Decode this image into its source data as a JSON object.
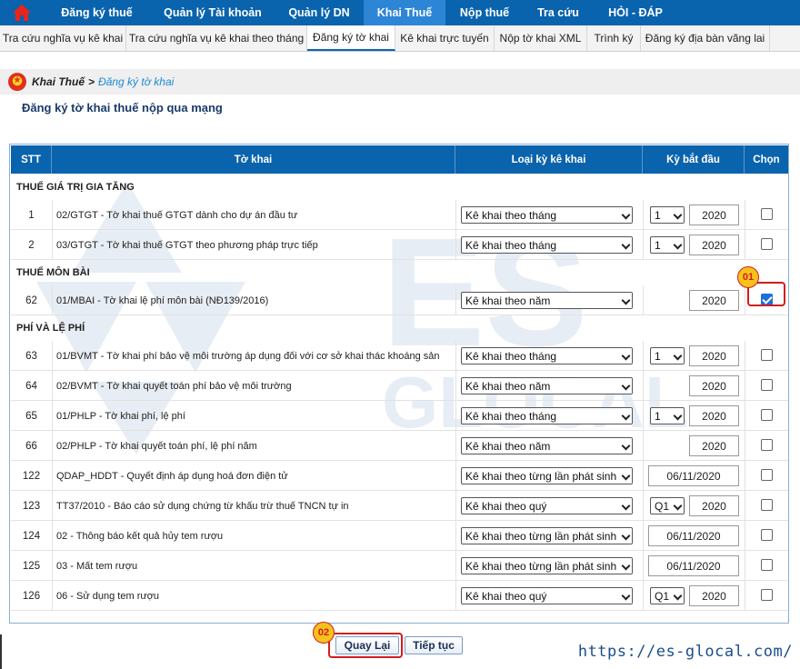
{
  "top_nav": {
    "home_icon": "home-icon",
    "items": [
      {
        "label": "Đăng ký thuế",
        "active": false
      },
      {
        "label": "Quản lý Tài khoản",
        "active": false
      },
      {
        "label": "Quản lý DN",
        "active": false
      },
      {
        "label": "Khai Thuế",
        "active": true
      },
      {
        "label": "Nộp thuế",
        "active": false
      },
      {
        "label": "Tra cứu",
        "active": false
      },
      {
        "label": "HỎI - ĐÁP",
        "active": false
      }
    ]
  },
  "sub_nav": {
    "items": [
      {
        "label": "Tra cứu nghĩa vụ kê khai",
        "active": false
      },
      {
        "label": "Tra cứu nghĩa vụ kê khai theo tháng",
        "active": false
      },
      {
        "label": "Đăng ký tờ khai",
        "active": true
      },
      {
        "label": "Kê khai trực tuyến",
        "active": false
      },
      {
        "label": "Nộp tờ khai XML",
        "active": false
      },
      {
        "label": "Trình ký",
        "active": false
      },
      {
        "label": "Đăng ký địa bàn vãng lai",
        "active": false
      }
    ]
  },
  "breadcrumb": {
    "root": "Khai Thuế",
    "separator": ">",
    "current": "Đăng ký tờ khai"
  },
  "page_title": "Đăng ký tờ khai thuế nộp qua mạng",
  "table": {
    "headers": {
      "stt": "STT",
      "to_khai": "Tờ khai",
      "loai_ky": "Loại kỳ kê khai",
      "ky_bat_dau": "Kỳ bắt đầu",
      "chon": "Chọn"
    },
    "sections": [
      {
        "title": "THUẾ GIÁ TRỊ GIA TĂNG",
        "rows": [
          {
            "stt": "1",
            "name": "02/GTGT - Tờ khai thuế GTGT dành cho dự án đầu tư",
            "loai": "Kê khai theo tháng",
            "period": "1",
            "year": "2020",
            "checked": false
          },
          {
            "stt": "2",
            "name": "03/GTGT - Tờ khai thuế GTGT theo phương pháp trực tiếp",
            "loai": "Kê khai theo tháng",
            "period": "1",
            "year": "2020",
            "checked": false
          }
        ]
      },
      {
        "title": "THUẾ MÔN BÀI",
        "rows": [
          {
            "stt": "62",
            "name": "01/MBAI - Tờ khai lệ phí môn bài (NĐ139/2016)",
            "loai": "Kê khai theo năm",
            "period": "",
            "year": "2020",
            "checked": true
          }
        ]
      },
      {
        "title": "PHÍ VÀ LỆ PHÍ",
        "rows": [
          {
            "stt": "63",
            "name": "01/BVMT - Tờ khai phí bảo vệ môi trường áp dụng đối với cơ sở khai thác khoáng sản",
            "loai": "Kê khai theo tháng",
            "period": "1",
            "year": "2020",
            "checked": false
          },
          {
            "stt": "64",
            "name": "02/BVMT - Tờ khai quyết toán phí bảo vệ môi trường",
            "loai": "Kê khai theo năm",
            "period": "",
            "year": "2020",
            "checked": false
          },
          {
            "stt": "65",
            "name": "01/PHLP - Tờ khai phí, lệ phí",
            "loai": "Kê khai theo tháng",
            "period": "1",
            "year": "2020",
            "checked": false
          },
          {
            "stt": "66",
            "name": "02/PHLP - Tờ khai quyết toán phí, lệ phí năm",
            "loai": "Kê khai theo năm",
            "period": "",
            "year": "2020",
            "checked": false
          },
          {
            "stt": "122",
            "name": "QDAP_HDDT - Quyết định áp dụng hoá đơn điện tử",
            "loai": "Kê khai theo từng lần phát sinh",
            "period": "",
            "year": "06/11/2020",
            "checked": false
          },
          {
            "stt": "123",
            "name": "TT37/2010 - Báo cáo sử dụng chứng từ khấu trừ thuế TNCN tự in",
            "loai": "Kê khai theo quý",
            "period": "Q1",
            "year": "2020",
            "checked": false
          },
          {
            "stt": "124",
            "name": "02 - Thông báo kết quả hủy tem rượu",
            "loai": "Kê khai theo từng lần phát sinh",
            "period": "",
            "year": "06/11/2020",
            "checked": false
          },
          {
            "stt": "125",
            "name": "03 - Mất tem rượu",
            "loai": "Kê khai theo từng lần phát sinh",
            "period": "",
            "year": "06/11/2020",
            "checked": false
          },
          {
            "stt": "126",
            "name": "06 - Sử dụng tem rượu",
            "loai": "Kê khai theo quý",
            "period": "Q1",
            "year": "2020",
            "checked": false
          }
        ]
      }
    ]
  },
  "annotations": {
    "step1": "01",
    "step2": "02"
  },
  "buttons": {
    "back": "Quay Lại",
    "next": "Tiếp tục"
  },
  "watermark": {
    "letters": "ES",
    "sub": "GLOCAL"
  },
  "footer": {
    "url": "https://es-glocal.com/"
  },
  "colors": {
    "nav_bg": "#0a63ad",
    "nav_active": "#2d85d6",
    "highlight": "#d21d1d",
    "badge": "#f6c21c"
  }
}
